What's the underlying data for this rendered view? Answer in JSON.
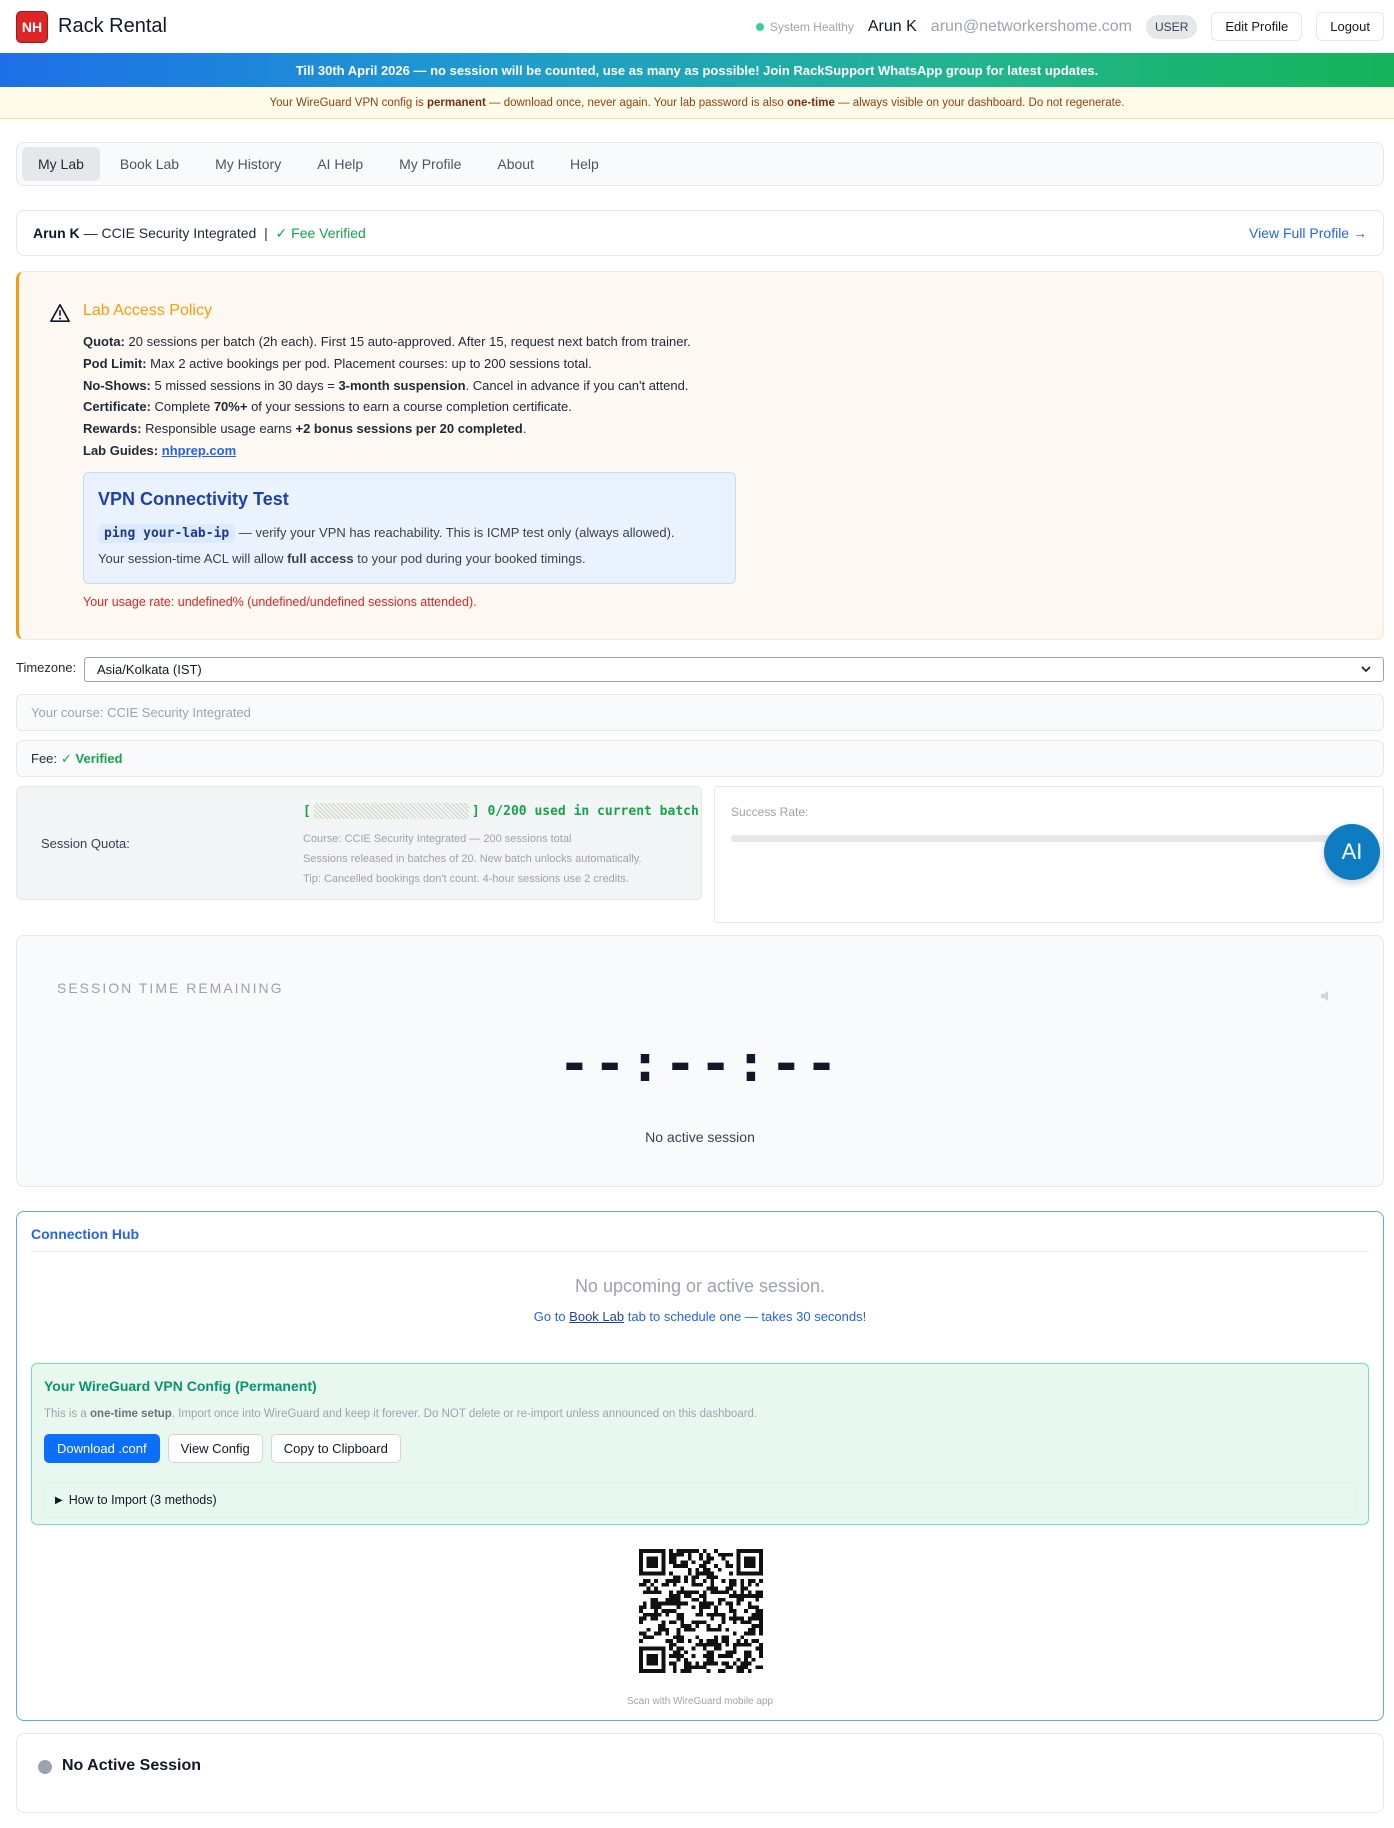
{
  "header": {
    "logo": "NH",
    "title": "Rack Rental",
    "status": "System Healthy",
    "user_name": "Arun K",
    "email": "arun@networkershome.com",
    "role": "USER",
    "edit_profile": "Edit Profile",
    "logout": "Logout"
  },
  "banner": {
    "main": "Till 30th April 2026 — no session will be counted, use as many as possible! Join RackSupport WhatsApp group for latest updates.",
    "warn_pre": "Your WireGuard VPN config is",
    "warn_b1": "permanent",
    "warn_mid": "— download once, never again. Your lab password is also",
    "warn_b2": "one-time",
    "warn_post": "— always visible on your dashboard. Do not regenerate."
  },
  "nav": {
    "tabs": [
      "My Lab",
      "Book Lab",
      "My History",
      "AI Help",
      "My Profile",
      "About",
      "Help"
    ]
  },
  "profile": {
    "name": "Arun K",
    "course": "— CCIE Security Integrated",
    "sep": "|",
    "fee": "✓ Fee Verified",
    "link": "View Full Profile →"
  },
  "policy": {
    "title": "Lab Access Policy",
    "quota_k": "Quota:",
    "quota_v": "20 sessions per batch (2h each). First 15 auto-approved. After 15, request next batch from trainer.",
    "pod_k": "Pod Limit:",
    "pod_v": "Max 2 active bookings per pod. Placement courses: up to 200 sessions total.",
    "noshow_k": "No-Shows:",
    "noshow_v1": "5 missed sessions in 30 days =",
    "noshow_b": "3-month suspension",
    "noshow_v2": ". Cancel in advance if you can't attend.",
    "cert_k": "Certificate:",
    "cert_v1": "Complete",
    "cert_b": "70%+",
    "cert_v2": "of your sessions to earn a course completion certificate.",
    "rewards_k": "Rewards:",
    "rewards_v1": "Responsible usage earns",
    "rewards_b": "+2 bonus sessions per 20 completed",
    "rewards_v2": ".",
    "guides_k": "Lab Guides:",
    "guides_link": "nhprep.com",
    "vpn_title": "VPN Connectivity Test",
    "vpn_code": "ping your-lab-ip",
    "vpn_line1": "— verify your VPN has reachability. This is ICMP test only (always allowed).",
    "vpn_line2_pre": "Your session-time ACL will allow",
    "vpn_line2_b": "full access",
    "vpn_line2_post": "to your pod during your booked timings.",
    "usage": "Your usage rate: undefined% (undefined/undefined sessions attended)."
  },
  "timezone": {
    "label": "Timezone:",
    "value": "Asia/Kolkata (IST)"
  },
  "course_field": "Your course: CCIE Security Integrated",
  "fee_field": {
    "label": "Fee:",
    "value": "✓ Verified"
  },
  "quota": {
    "label": "Session Quota:",
    "open": "[",
    "close": "] 0/200 used in current batch",
    "used": 0,
    "total": 200,
    "note1": "Course: CCIE Security Integrated — 200 sessions total",
    "note2": "Sessions released in batches of 20. New batch unlocks automatically.",
    "note3": "Tip: Cancelled bookings don't count. 4-hour sessions use 2 credits."
  },
  "success": {
    "label": "Success Rate:"
  },
  "ai_button": "AI",
  "timer": {
    "title": "SESSION TIME REMAINING",
    "digits": "--:--:--",
    "status": "No active session"
  },
  "hub": {
    "title": "Connection Hub",
    "empty": "No upcoming or active session.",
    "hint_pre": "Go to",
    "hint_link": "Book Lab",
    "hint_post": "tab to schedule one — takes 30 seconds!",
    "wg_title": "Your WireGuard VPN Config (Permanent)",
    "wg_desc_pre": "This is a",
    "wg_desc_b": "one-time setup",
    "wg_desc_post": ". Import once into WireGuard and keep it forever. Do NOT delete or re-import unless announced on this dashboard.",
    "btn_download": "Download .conf",
    "btn_view": "View Config",
    "btn_copy": "Copy to Clipboard",
    "details": "How to Import (3 methods)",
    "qr_caption": "Scan with WireGuard mobile app"
  },
  "session": {
    "label": "No Active Session"
  },
  "colors": {
    "accent": "#2563eb",
    "success": "#16a34a",
    "warning": "#f59e0b",
    "danger": "#dc2626"
  }
}
